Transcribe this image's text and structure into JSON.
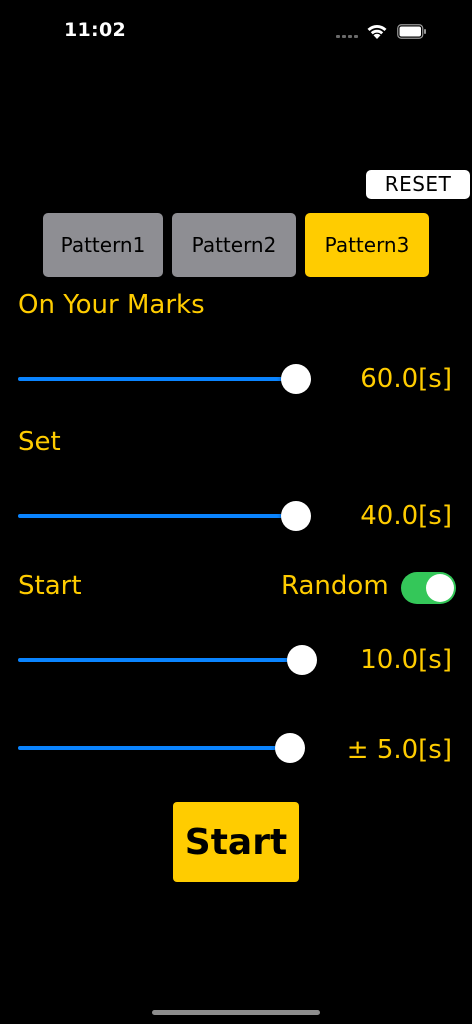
{
  "status_bar": {
    "time": "11:02"
  },
  "reset_label": "RESET",
  "patterns": [
    "Pattern1",
    "Pattern2",
    "Pattern3"
  ],
  "active_pattern": "Pattern3",
  "on_your_marks": {
    "label": "On Your Marks",
    "value_text": "60.0[s]"
  },
  "set": {
    "label": "Set",
    "value_text": "40.0[s]"
  },
  "start_section": {
    "label": "Start",
    "random_label": "Random",
    "random_enabled": true,
    "value_text": "10.0[s]",
    "random_range_text": "± 5.0[s]"
  },
  "start_button_label": "Start",
  "colors": {
    "accent": "#ffcc00",
    "slider": "#0a84ff",
    "toggle_on": "#34c759",
    "inactive": "#8e8e93"
  }
}
